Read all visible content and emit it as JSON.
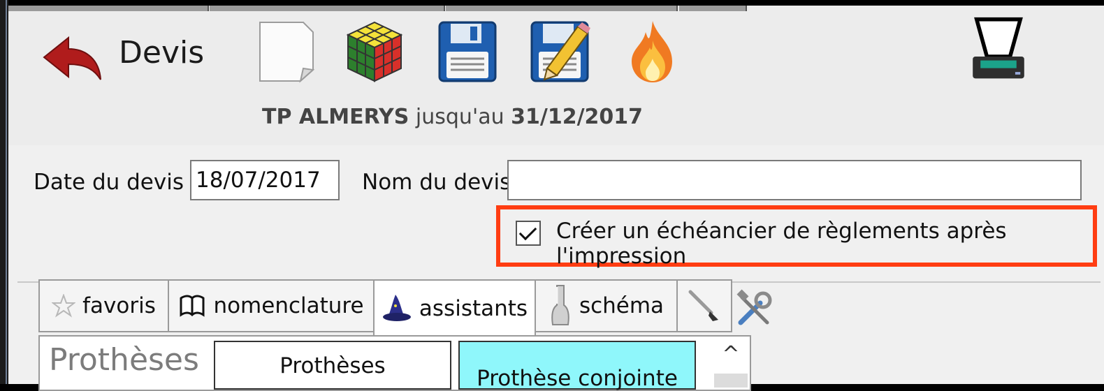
{
  "header": {
    "title": "Devis",
    "tp_prefix": "TP ALMERYS",
    "tp_middle": " jusqu'au ",
    "tp_date": "31/12/2017"
  },
  "toolbar": {
    "icons": [
      "back-arrow-icon",
      "new-document-icon",
      "rubiks-cube-icon",
      "save-icon",
      "save-edit-icon",
      "fire-icon",
      "scanner-icon"
    ]
  },
  "form": {
    "date_label": "Date du devis :",
    "date_value": "18/07/2017",
    "nom_label": "Nom du devis",
    "nom_value": "",
    "checkbox_label": "Créer un échéancier de règlements après l'impression",
    "checkbox_checked": true
  },
  "tabs": [
    {
      "label": "favoris",
      "icon": "star-icon"
    },
    {
      "label": "nomenclature",
      "icon": "book-icon"
    },
    {
      "label": "assistants",
      "icon": "wizard-hat-icon",
      "active": true
    },
    {
      "label": "schéma",
      "icon": "tooth-icon"
    },
    {
      "label": "",
      "icon": "brush-icon"
    }
  ],
  "panel": {
    "title": "Prothèses",
    "buttons": [
      "Prothèses",
      "Prothèse conjointe"
    ]
  },
  "colors": {
    "highlight": "#ff3d12",
    "selected_button": "#8ff7fb",
    "back_arrow": "#b01c1c"
  }
}
